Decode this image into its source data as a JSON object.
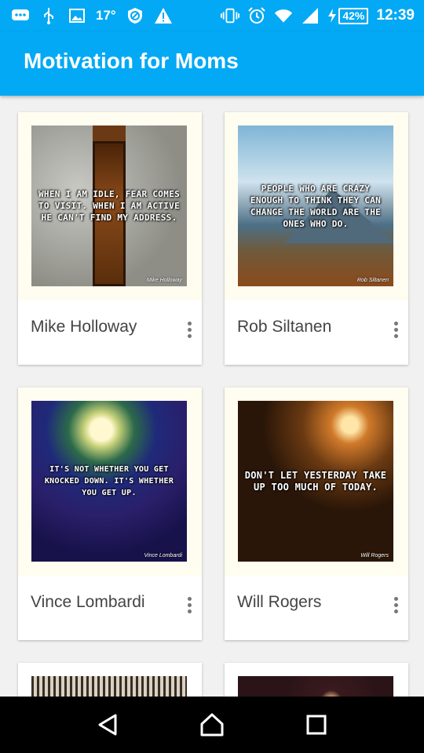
{
  "status_bar": {
    "temperature": "17°",
    "battery": "42%",
    "time": "12:39"
  },
  "app_bar": {
    "title": "Motivation for Moms"
  },
  "cards": [
    {
      "author": "Mike Holloway",
      "quote": "When I am idle, fear comes to visit. When I am active he can't find my address.",
      "credit": "Mike Holloway"
    },
    {
      "author": "Rob Siltanen",
      "quote": "People who are crazy enough to think they can change the world are the ones who do.",
      "credit": "Rob Siltanen"
    },
    {
      "author": "Vince Lombardi",
      "quote": "It's not whether you get knocked down. It's whether you get up.",
      "credit": "Vince Lombardi"
    },
    {
      "author": "Will Rogers",
      "quote": "Don't let yesterday take up too much of today.",
      "credit": "Will Rogers"
    }
  ],
  "colors": {
    "primary": "#03A9F4",
    "card_bg": "#ffffff",
    "text": "#444444"
  }
}
